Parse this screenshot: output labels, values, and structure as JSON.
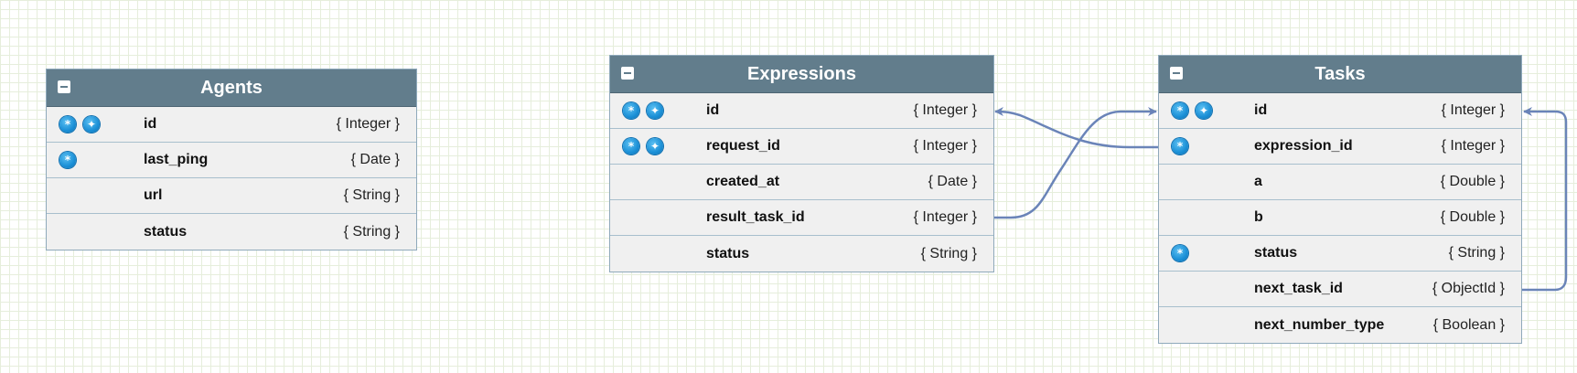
{
  "entities": [
    {
      "title": "Agents",
      "fields": [
        {
          "name": "id",
          "type": "{ Integer }",
          "icons": [
            "primary-key-icon",
            "unique-key-icon"
          ]
        },
        {
          "name": "last_ping",
          "type": "{ Date }",
          "icons": [
            "primary-key-icon"
          ]
        },
        {
          "name": "url",
          "type": "{ String }",
          "icons": []
        },
        {
          "name": "status",
          "type": "{ String }",
          "icons": []
        }
      ]
    },
    {
      "title": "Expressions",
      "fields": [
        {
          "name": "id",
          "type": "{ Integer }",
          "icons": [
            "primary-key-icon",
            "unique-key-icon"
          ]
        },
        {
          "name": "request_id",
          "type": "{ Integer }",
          "icons": [
            "primary-key-icon",
            "unique-key-icon"
          ]
        },
        {
          "name": "created_at",
          "type": "{ Date }",
          "icons": []
        },
        {
          "name": "result_task_id",
          "type": "{ Integer }",
          "icons": []
        },
        {
          "name": "status",
          "type": "{ String }",
          "icons": []
        }
      ]
    },
    {
      "title": "Tasks",
      "fields": [
        {
          "name": "id",
          "type": "{ Integer }",
          "icons": [
            "primary-key-icon",
            "unique-key-icon"
          ]
        },
        {
          "name": "expression_id",
          "type": "{ Integer }",
          "icons": [
            "primary-key-icon"
          ]
        },
        {
          "name": "a",
          "type": "{ Double }",
          "icons": []
        },
        {
          "name": "b",
          "type": "{ Double }",
          "icons": []
        },
        {
          "name": "status",
          "type": "{ String }",
          "icons": [
            "primary-key-icon"
          ]
        },
        {
          "name": "next_task_id",
          "type": "{ ObjectId }",
          "icons": []
        },
        {
          "name": "next_number_type",
          "type": "{ Boolean }",
          "icons": []
        }
      ]
    }
  ],
  "colors": {
    "header": "#627d8c",
    "row": "#f0f0f0",
    "border": "#8fa9bb",
    "relation": "#6a84b8",
    "key_icon": "#1a8fd6"
  }
}
